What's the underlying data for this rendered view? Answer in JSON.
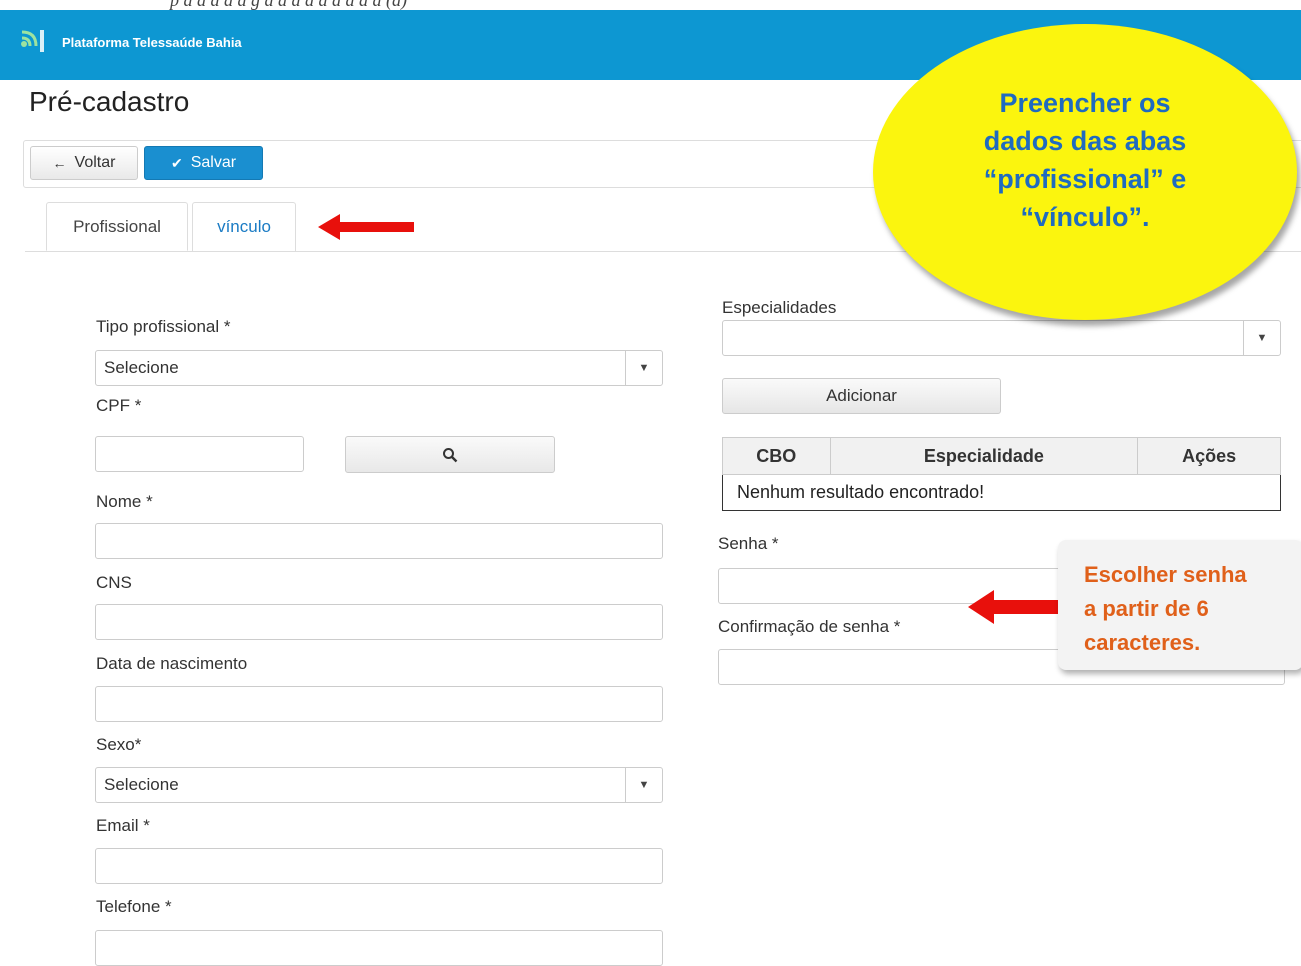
{
  "header": {
    "cut_caption": "p d d d d d g d d d d d d d d d (d)",
    "brand": "Plataforma Telessaúde Bahia",
    "logo_icon": "signal-wave-icon",
    "color": "#0d97d2"
  },
  "page": {
    "title": "Pré-cadastro"
  },
  "toolbar": {
    "back_label": "Voltar",
    "back_icon": "arrow-left-icon",
    "save_label": "Salvar",
    "save_icon": "check-icon",
    "save_color": "#1a8fd0"
  },
  "tabs": [
    {
      "label": "Profissional",
      "active": true
    },
    {
      "label": "vínculo",
      "active": false
    }
  ],
  "form": {
    "tipo_profissional": {
      "label": "Tipo profissional *",
      "value": "Selecione"
    },
    "cpf": {
      "label": "CPF *",
      "value": "",
      "search_icon": "search-icon"
    },
    "nome": {
      "label": "Nome *",
      "value": ""
    },
    "cns": {
      "label": "CNS",
      "value": ""
    },
    "data_nascimento": {
      "label": "Data de nascimento",
      "value": ""
    },
    "sexo": {
      "label": "Sexo*",
      "value": "Selecione"
    },
    "email": {
      "label": "Email *",
      "value": ""
    },
    "telefone": {
      "label": "Telefone *",
      "value": ""
    }
  },
  "especialidades": {
    "label": "Especialidades",
    "value": "",
    "add_label": "Adicionar",
    "table": {
      "columns": [
        "CBO",
        "Especialidade",
        "Ações"
      ],
      "empty_message": "Nenhum resultado encontrado!"
    }
  },
  "senha": {
    "label": "Senha *",
    "confirm_label": "Confirmação de senha *"
  },
  "annotations": {
    "balloon": {
      "lines": [
        "Preencher os",
        "dados das abas",
        "“profissional” e",
        "“vínculo”."
      ],
      "fill": "#fbf50e",
      "text_color": "#1f6bc0"
    },
    "note": {
      "lines": [
        "Escolher senha",
        "a partir de 6",
        "caracteres."
      ],
      "text_color": "#e0601a"
    },
    "arrow_color": "#e8100c"
  }
}
